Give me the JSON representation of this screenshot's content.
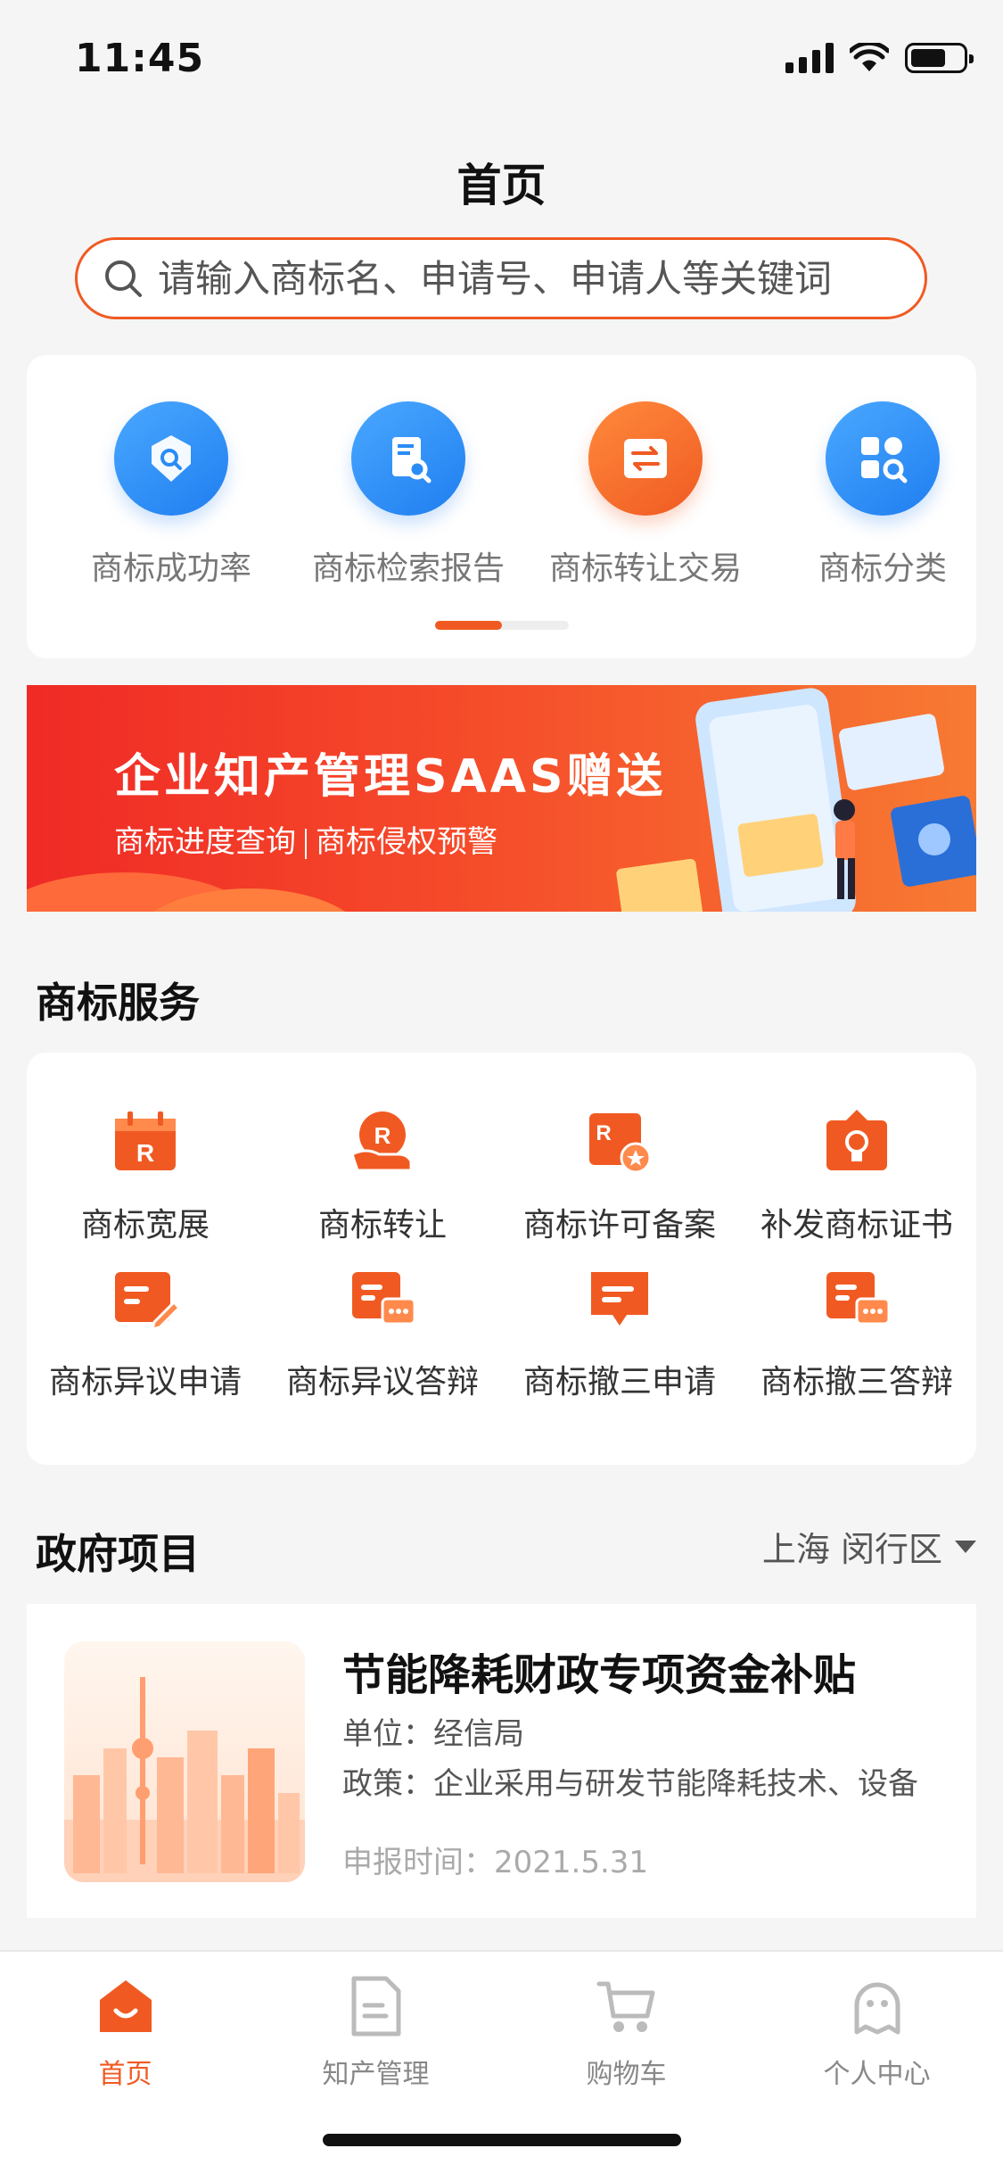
{
  "status_bar": {
    "time": "11:45"
  },
  "header": {
    "title": "首页"
  },
  "search": {
    "placeholder": "请输入商标名、申请号、申请人等关键词"
  },
  "quick_links": [
    {
      "label": "商标成功率",
      "icon": "shield-search-icon",
      "color": "#2a8cf5"
    },
    {
      "label": "商标检索报告",
      "icon": "report-search-icon",
      "color": "#2a8cf5"
    },
    {
      "label": "商标转让交易",
      "icon": "transfer-icon",
      "color": "#f05a22"
    },
    {
      "label": "商标分类",
      "icon": "category-search-icon",
      "color": "#2a8cf5"
    }
  ],
  "banner": {
    "title": "企业知产管理SAAS赠送",
    "sub_left": "商标进度查询",
    "sub_right": "商标侵权预警"
  },
  "services": {
    "title": "商标服务",
    "items": [
      {
        "label": "商标宽展",
        "icon": "calendar-r-icon"
      },
      {
        "label": "商标转让",
        "icon": "hand-r-icon"
      },
      {
        "label": "商标许可备案",
        "icon": "license-icon"
      },
      {
        "label": "补发商标证书",
        "icon": "certificate-icon"
      },
      {
        "label": "商标异议申请",
        "icon": "doc-edit-icon"
      },
      {
        "label": "商标异议答辩",
        "icon": "doc-chat-icon"
      },
      {
        "label": "商标撤三申请",
        "icon": "chat-doc-icon"
      },
      {
        "label": "商标撤三答辩",
        "icon": "doc-chat-icon"
      }
    ]
  },
  "gov": {
    "title": "政府项目",
    "region": "上海  闵行区",
    "item": {
      "title": "节能降耗财政专项资金补贴",
      "unit": "单位：经信局",
      "policy": "政策：企业采用与研发节能降耗技术、设备",
      "date": "申报时间：2021.5.31"
    }
  },
  "tabs": [
    {
      "label": "首页",
      "icon": "home-icon",
      "active": true
    },
    {
      "label": "知产管理",
      "icon": "document-icon",
      "active": false
    },
    {
      "label": "购物车",
      "icon": "cart-icon",
      "active": false
    },
    {
      "label": "个人中心",
      "icon": "profile-icon",
      "active": false
    }
  ],
  "colors": {
    "accent": "#f05a22",
    "blue": "#2a8cf5"
  }
}
